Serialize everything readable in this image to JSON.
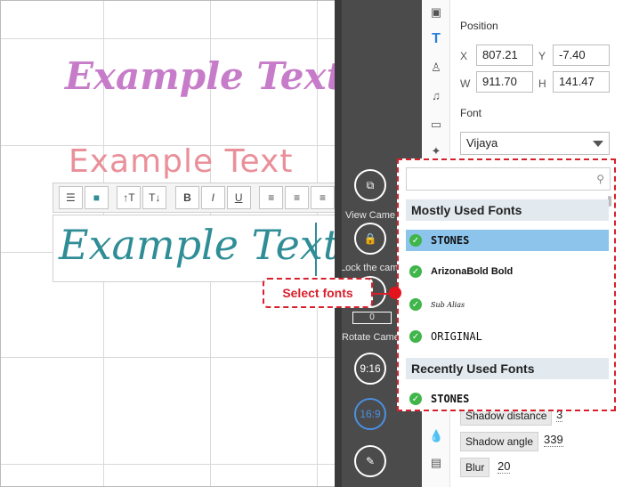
{
  "canvas": {
    "sample_texts": [
      "Example Text",
      "Example Text",
      "Example Text"
    ]
  },
  "text_toolbar": {
    "buttons": [
      {
        "icon": "list-icon",
        "glyph": "☰"
      },
      {
        "icon": "color-fill-icon",
        "glyph": "■"
      },
      {
        "icon": "increase-font-size-icon",
        "glyph": "↑T"
      },
      {
        "icon": "decrease-font-size-icon",
        "glyph": "T↓"
      },
      {
        "icon": "bold-icon",
        "glyph": "B"
      },
      {
        "icon": "italic-icon",
        "glyph": "I"
      },
      {
        "icon": "underline-icon",
        "glyph": "U"
      },
      {
        "icon": "align-left-icon",
        "glyph": "≡"
      },
      {
        "icon": "align-center-icon",
        "glyph": "≡"
      },
      {
        "icon": "align-right-icon",
        "glyph": "≡"
      },
      {
        "icon": "align-justify-icon",
        "glyph": "≡"
      }
    ]
  },
  "side_toolbar": {
    "view_camera_label": "View Came",
    "lock_camera_label": "Lock the cam",
    "rotate_camera_label": "Rotate Came",
    "rotate_value": "0",
    "ratio_916": "9:16",
    "ratio_169": "16:9"
  },
  "properties": {
    "position_label": "Position",
    "x_tag": "X",
    "x_value": "807.21",
    "y_tag": "Y",
    "y_value": "-7.40",
    "w_tag": "W",
    "w_value": "911.70",
    "h_tag": "H",
    "h_value": "141.47",
    "font_label": "Font",
    "font_value": "Vijaya",
    "shadow_distance_label": "Shadow distance",
    "shadow_distance_value": "3",
    "shadow_angle_label": "Shadow angle",
    "shadow_angle_value": "339",
    "blur_label": "Blur",
    "blur_value": "20"
  },
  "font_dropdown": {
    "mostly_used_heading": "Mostly Used Fonts",
    "mostly_used": [
      "STONES",
      "ArizonaBold Bold",
      "Sub Alias",
      "ORIGINAL"
    ],
    "recently_used_heading": "Recently Used Fonts",
    "recently_used": [
      "STONES"
    ]
  },
  "callout": {
    "text": "Select fonts"
  },
  "colors": {
    "accent_red": "#d8202c",
    "selected_row": "#8cc4ec",
    "check_green": "#3fb54a"
  }
}
